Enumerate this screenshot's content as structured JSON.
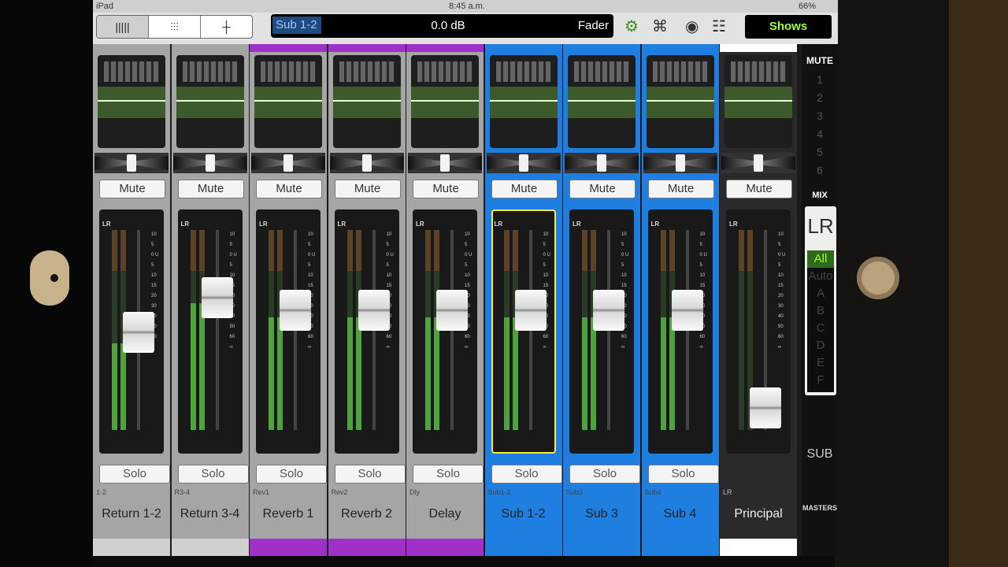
{
  "statusbar": {
    "device": "iPad",
    "time": "8:45 a.m.",
    "battery": "66%"
  },
  "toolbar": {
    "views": [
      "mixer-view",
      "faders-view",
      "single-view"
    ],
    "display": {
      "channel": "Sub 1-2",
      "value": "0.0 dB",
      "mode": "Fader"
    },
    "shows_label": "Shows"
  },
  "strips": [
    {
      "name": "Return 1-2",
      "tag": "1-2",
      "mute": "Mute",
      "solo": "Solo",
      "color": "#b5b5b5",
      "level": 0.48
    },
    {
      "name": "Return 3-4",
      "tag": "R3-4",
      "mute": "Mute",
      "solo": "Solo",
      "color": "#b5b5b5",
      "level": 0.7
    },
    {
      "name": "Reverb 1",
      "tag": "Rev1",
      "mute": "Mute",
      "solo": "Solo",
      "color": "#a030c8",
      "level": 0.62
    },
    {
      "name": "Reverb 2",
      "tag": "Rev2",
      "mute": "Mute",
      "solo": "Solo",
      "color": "#a030c8",
      "level": 0.62
    },
    {
      "name": "Delay",
      "tag": "Dly",
      "mute": "Mute",
      "solo": "Solo",
      "color": "#a030c8",
      "level": 0.62
    },
    {
      "name": "Sub 1-2",
      "tag": "Sub1-2",
      "mute": "Mute",
      "solo": "Solo",
      "color": "#1e7fe0",
      "level": 0.62
    },
    {
      "name": "Sub 3",
      "tag": "Sub3",
      "mute": "Mute",
      "solo": "Solo",
      "color": "#1e7fe0",
      "level": 0.62
    },
    {
      "name": "Sub 4",
      "tag": "Sub4",
      "mute": "Mute",
      "solo": "Solo",
      "color": "#1e7fe0",
      "level": 0.62
    },
    {
      "name": "Principal",
      "tag": "LR",
      "mute": "Mute",
      "solo": "",
      "color": "#ffffff",
      "level": 0.0
    }
  ],
  "right_panel": {
    "mute_label": "MUTE",
    "mute_groups": [
      "1",
      "2",
      "3",
      "4",
      "5",
      "6"
    ],
    "mix_label": "MIX",
    "mix_current": "LR",
    "mix_options": [
      "All",
      "Auto",
      "A",
      "B",
      "C",
      "D",
      "E",
      "F"
    ],
    "sub_label": "SUB",
    "masters_label": "MASTERS"
  },
  "fader_scale": [
    "10",
    "5",
    "0 U",
    "5",
    "10",
    "15",
    "20",
    "30",
    "40",
    "50",
    "60",
    "∞"
  ],
  "colors": {
    "accent_green": "#9dff3c",
    "selected": "#ffe93b",
    "fx_purple": "#a030c8",
    "sub_blue": "#1e7fe0"
  }
}
